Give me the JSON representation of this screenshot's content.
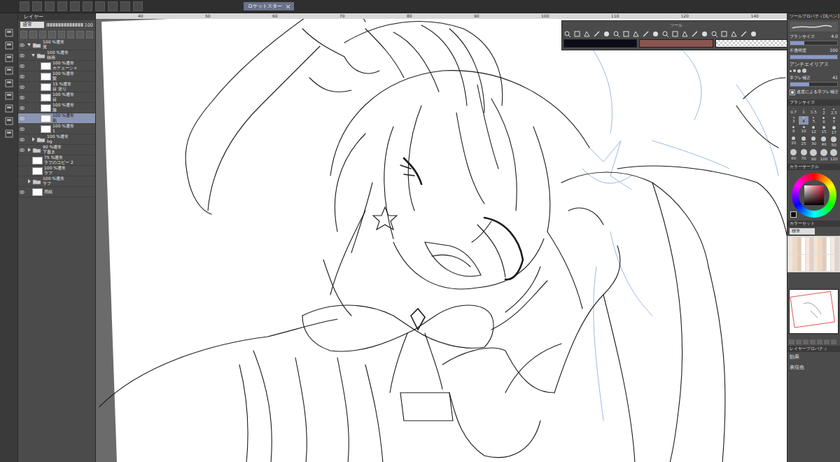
{
  "canvas_tab": {
    "label": "ロケットスター"
  },
  "ruler": [
    "40",
    "50",
    "60",
    "70",
    "80",
    "90",
    "100",
    "110",
    "120",
    "140"
  ],
  "layer_panel": {
    "title": "レイヤー",
    "blend_mode": "通常",
    "opacity": "100",
    "layers": [
      {
        "mode": "100 %通常",
        "name": "翼",
        "kind": "folder",
        "depth": 0,
        "expanded": true,
        "visible": true,
        "selected": false
      },
      {
        "mode": "100 %通常",
        "name": "線画",
        "kind": "folder",
        "depth": 1,
        "expanded": true,
        "visible": true,
        "selected": false
      },
      {
        "mode": "100 %通常",
        "name": "カチューシャ",
        "kind": "layer",
        "depth": 2,
        "expanded": false,
        "visible": true,
        "selected": false
      },
      {
        "mode": "100 %通常",
        "name": "髪",
        "kind": "layer",
        "depth": 2,
        "expanded": false,
        "visible": true,
        "selected": false
      },
      {
        "mode": "15 %通常",
        "name": "目 塗り",
        "kind": "layer",
        "depth": 2,
        "expanded": false,
        "visible": true,
        "selected": false
      },
      {
        "mode": "100 %通常",
        "name": "目",
        "kind": "layer",
        "depth": 2,
        "expanded": false,
        "visible": true,
        "selected": false
      },
      {
        "mode": "100 %通常",
        "name": "服",
        "kind": "layer",
        "depth": 2,
        "expanded": false,
        "visible": true,
        "selected": false
      },
      {
        "mode": "100 %通常",
        "name": "肌",
        "kind": "layer",
        "depth": 2,
        "expanded": false,
        "visible": true,
        "selected": true
      },
      {
        "mode": "100 %通常",
        "name": "1",
        "kind": "layer",
        "depth": 2,
        "expanded": false,
        "visible": true,
        "selected": false
      },
      {
        "mode": "100 %通常",
        "name": "bg",
        "kind": "folder",
        "depth": 1,
        "expanded": false,
        "visible": true,
        "selected": false
      },
      {
        "mode": "90 %通常",
        "name": "下書き",
        "kind": "folder",
        "depth": 0,
        "expanded": false,
        "visible": true,
        "selected": false
      },
      {
        "mode": "75 %通常",
        "name": "ラフのコピー 2",
        "kind": "layer",
        "depth": 0,
        "expanded": false,
        "visible": false,
        "selected": false
      },
      {
        "mode": "100 %通常",
        "name": "ラフ",
        "kind": "layer",
        "depth": 0,
        "expanded": false,
        "visible": false,
        "selected": false
      },
      {
        "mode": "100 %通常",
        "name": "ラフ",
        "kind": "folder",
        "depth": 0,
        "expanded": false,
        "visible": false,
        "selected": false
      },
      {
        "name": "用紙",
        "kind": "paper",
        "depth": 0,
        "expanded": false,
        "visible": true,
        "selected": false
      }
    ]
  },
  "tool_palette": {
    "title": "ツール"
  },
  "colors": {
    "main": "#0c0c18",
    "sub": "#8a5450"
  },
  "tool_property": {
    "title": "ツールプロパティ[丸ペン]",
    "rows": [
      {
        "kind": "slider",
        "label": "ブラシサイズ",
        "value": "4.0",
        "level": 0.3
      },
      {
        "kind": "slider",
        "label": "不透明度",
        "value": "100",
        "level": 1
      },
      {
        "kind": "choice",
        "label": "アンチエイリアス"
      },
      {
        "kind": "slider",
        "label": "手ブレ補正",
        "value": "41",
        "level": 0.41
      },
      {
        "kind": "checkbox",
        "label": "速度による手ブレ補正",
        "checked": true
      }
    ]
  },
  "brush_size": {
    "title": "ブラシサイズ",
    "sizes": [
      {
        "label": "0.7",
        "selected": false
      },
      {
        "label": "1",
        "selected": false
      },
      {
        "label": "1.5",
        "selected": false
      },
      {
        "label": "2",
        "selected": false
      },
      {
        "label": "2.5",
        "selected": false
      },
      {
        "label": "3",
        "selected": false
      },
      {
        "label": "4",
        "selected": true
      },
      {
        "label": "5",
        "selected": false
      },
      {
        "label": "6",
        "selected": false
      },
      {
        "label": "7",
        "selected": false
      },
      {
        "label": "8",
        "selected": false
      },
      {
        "label": "10",
        "selected": false
      },
      {
        "label": "12",
        "selected": false
      },
      {
        "label": "15",
        "selected": false
      },
      {
        "label": "17",
        "selected": false
      },
      {
        "label": "20",
        "selected": false
      },
      {
        "label": "25",
        "selected": false
      },
      {
        "label": "30",
        "selected": false
      },
      {
        "label": "40",
        "selected": false
      },
      {
        "label": "50",
        "selected": false
      },
      {
        "label": "60",
        "selected": false
      },
      {
        "label": "70",
        "selected": false
      },
      {
        "label": "80",
        "selected": false
      },
      {
        "label": "100",
        "selected": false
      },
      {
        "label": "120",
        "selected": false
      }
    ]
  },
  "color_circle": {
    "title": "カラーサークル"
  },
  "color_set": {
    "title": "カラーセット",
    "set": "標準"
  },
  "layer_property": {
    "title": "レイヤープロパティ",
    "effect": "効果",
    "expression_color": "表現色"
  }
}
